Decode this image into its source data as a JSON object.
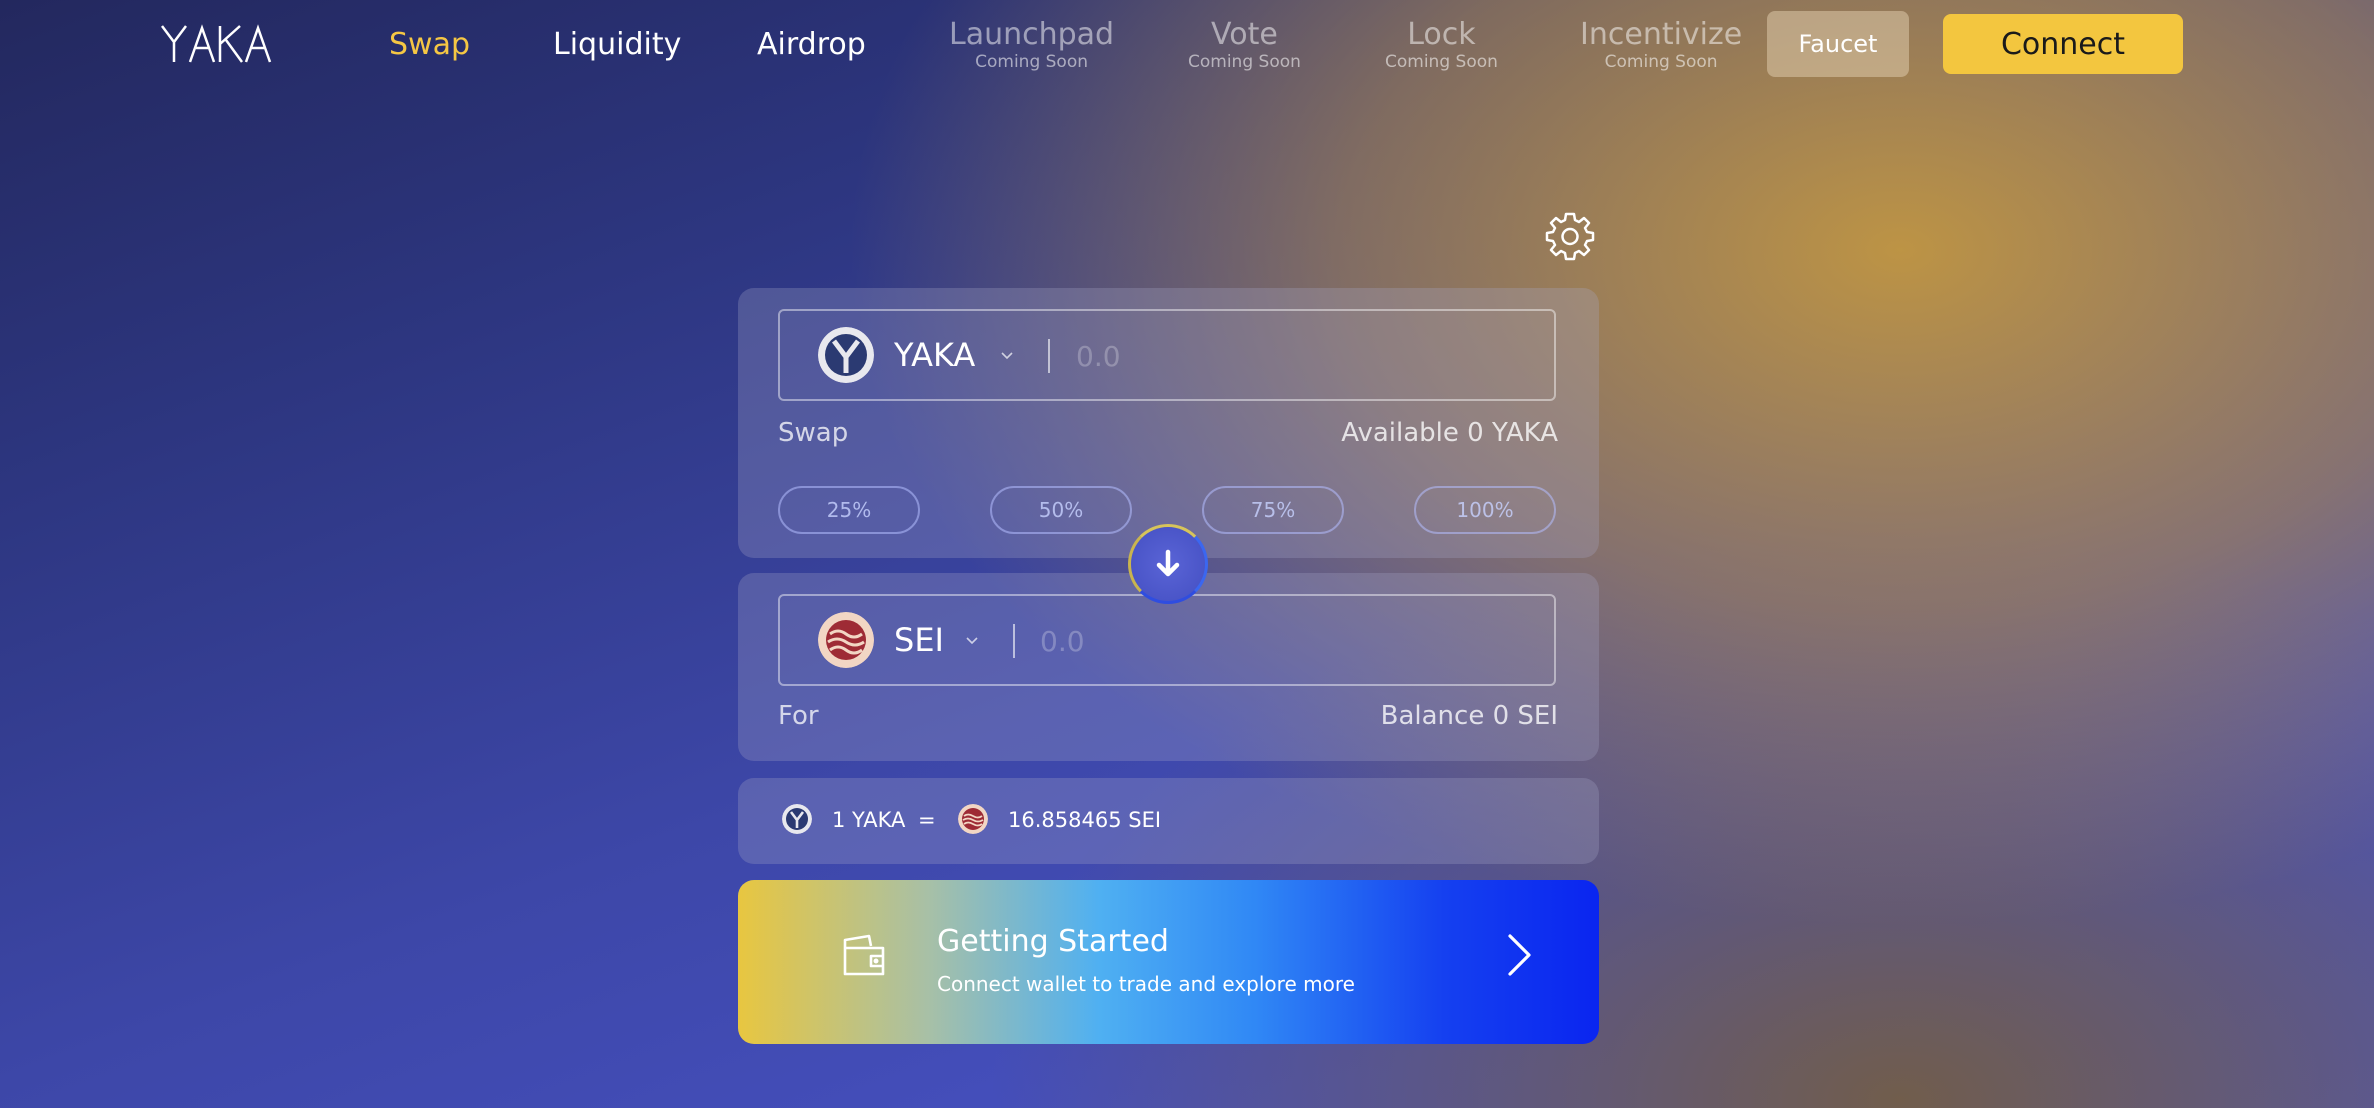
{
  "app": {
    "logo_text": "YAKA"
  },
  "nav": {
    "swap": "Swap",
    "liquidity": "Liquidity",
    "airdrop": "Airdrop",
    "launchpad": "Launchpad",
    "vote": "Vote",
    "lock": "Lock",
    "incentivize": "Incentivize",
    "coming_soon": "Coming Soon",
    "faucet": "Faucet",
    "connect": "Connect"
  },
  "swap": {
    "from_token": "YAKA",
    "from_placeholder": "0.0",
    "label": "Swap",
    "available": "Available 0 YAKA",
    "percents": [
      "25%",
      "50%",
      "75%",
      "100%"
    ],
    "to_token": "SEI",
    "to_placeholder": "0.0",
    "for_label": "For",
    "balance": "Balance 0 SEI"
  },
  "rate": {
    "left": "1 YAKA",
    "equals": "=",
    "right": "16.858465 SEI"
  },
  "cta": {
    "title": "Getting Started",
    "subtitle": "Connect wallet to trade and explore more"
  },
  "colors": {
    "accent": "#f3c63f",
    "active_nav": "#f5c744"
  },
  "icons": [
    "settings-gear-icon",
    "chevron-down-icon",
    "arrow-down-icon",
    "wallet-icon",
    "chevron-right-icon",
    "yaka-token-icon",
    "sei-token-icon"
  ]
}
